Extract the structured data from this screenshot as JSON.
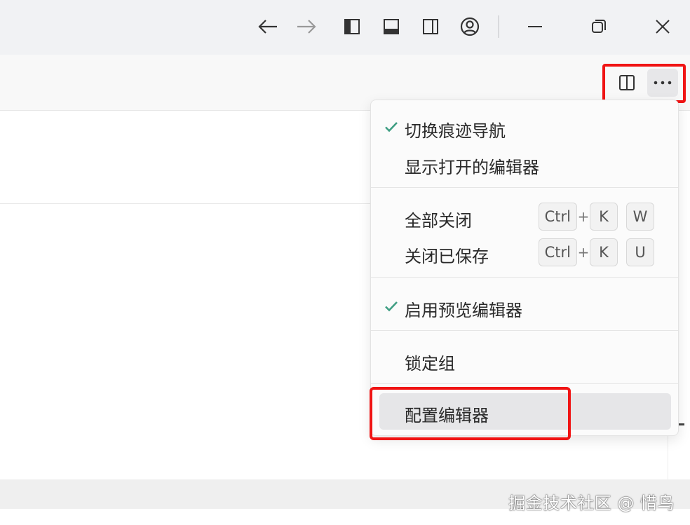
{
  "titlebar": {
    "buttons": [
      "back-arrow-icon",
      "forward-arrow-icon",
      "toggle-primary-sidebar-icon",
      "toggle-panel-icon",
      "toggle-secondary-sidebar-icon",
      "account-icon",
      "minimize-icon",
      "restore-icon",
      "close-icon"
    ]
  },
  "editor_actions": [
    "split-editor-icon",
    "more-actions-icon"
  ],
  "menu": {
    "items": [
      {
        "label": "切换痕迹导航",
        "checked": true
      },
      {
        "label": "显示打开的编辑器",
        "checked": false
      },
      {
        "label": "全部关闭",
        "shortcut": [
          "Ctrl",
          "+",
          "K",
          "W"
        ]
      },
      {
        "label": "关闭已保存",
        "shortcut": [
          "Ctrl",
          "+",
          "K",
          "U"
        ]
      },
      {
        "label": "启用预览编辑器",
        "checked": true
      },
      {
        "label": "锁定组",
        "checked": false
      },
      {
        "label": "配置编辑器",
        "checked": false
      }
    ]
  },
  "watermark": "掘金技术社区 @ 惜鸟",
  "colors": {
    "check": "#3f9e83",
    "highlight": "#f01414",
    "hover": "#e6e6e8"
  }
}
